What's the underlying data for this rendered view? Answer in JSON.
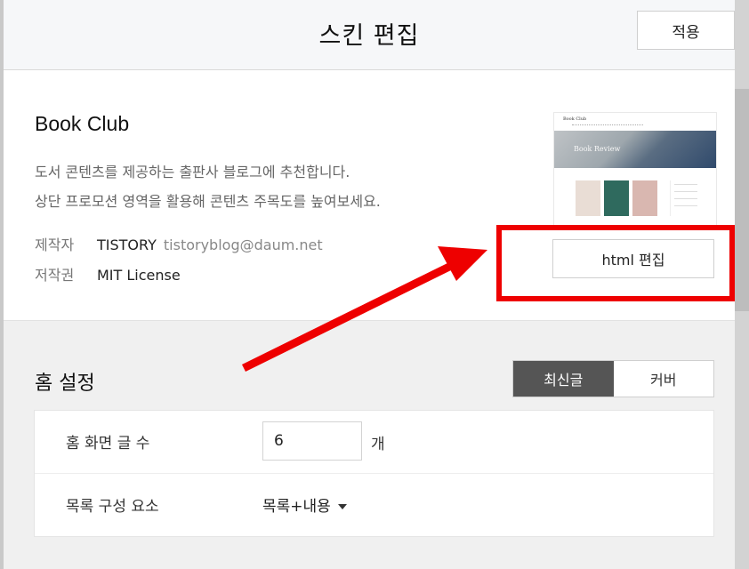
{
  "header": {
    "title": "스킨 편집",
    "apply_label": "적용"
  },
  "skin": {
    "name": "Book Club",
    "description": [
      "도서 콘텐츠를 제공하는 출판사 블로그에 추천합니다.",
      "상단 프로모션 영역을 활용해 콘텐츠 주목도를 높여보세요."
    ],
    "maker_label": "제작자",
    "maker_value": "TISTORY",
    "maker_email": "tistoryblog@daum.net",
    "license_label": "저작권",
    "license_value": "MIT License",
    "thumbnail": {
      "site_title": "Book Club",
      "hero_text": "Book Review"
    },
    "html_edit_label": "html 편집"
  },
  "home_settings": {
    "title": "홈 설정",
    "toggle": {
      "latest_label": "최신글",
      "cover_label": "커버",
      "active": "latest"
    },
    "post_count_label": "홈 화면 글 수",
    "post_count_value": "6",
    "post_count_unit": "개",
    "list_component_label": "목록 구성 요소",
    "list_component_value": "목록+내용"
  },
  "colors": {
    "highlight": "#ee0000",
    "toggle_active_bg": "#555555"
  }
}
